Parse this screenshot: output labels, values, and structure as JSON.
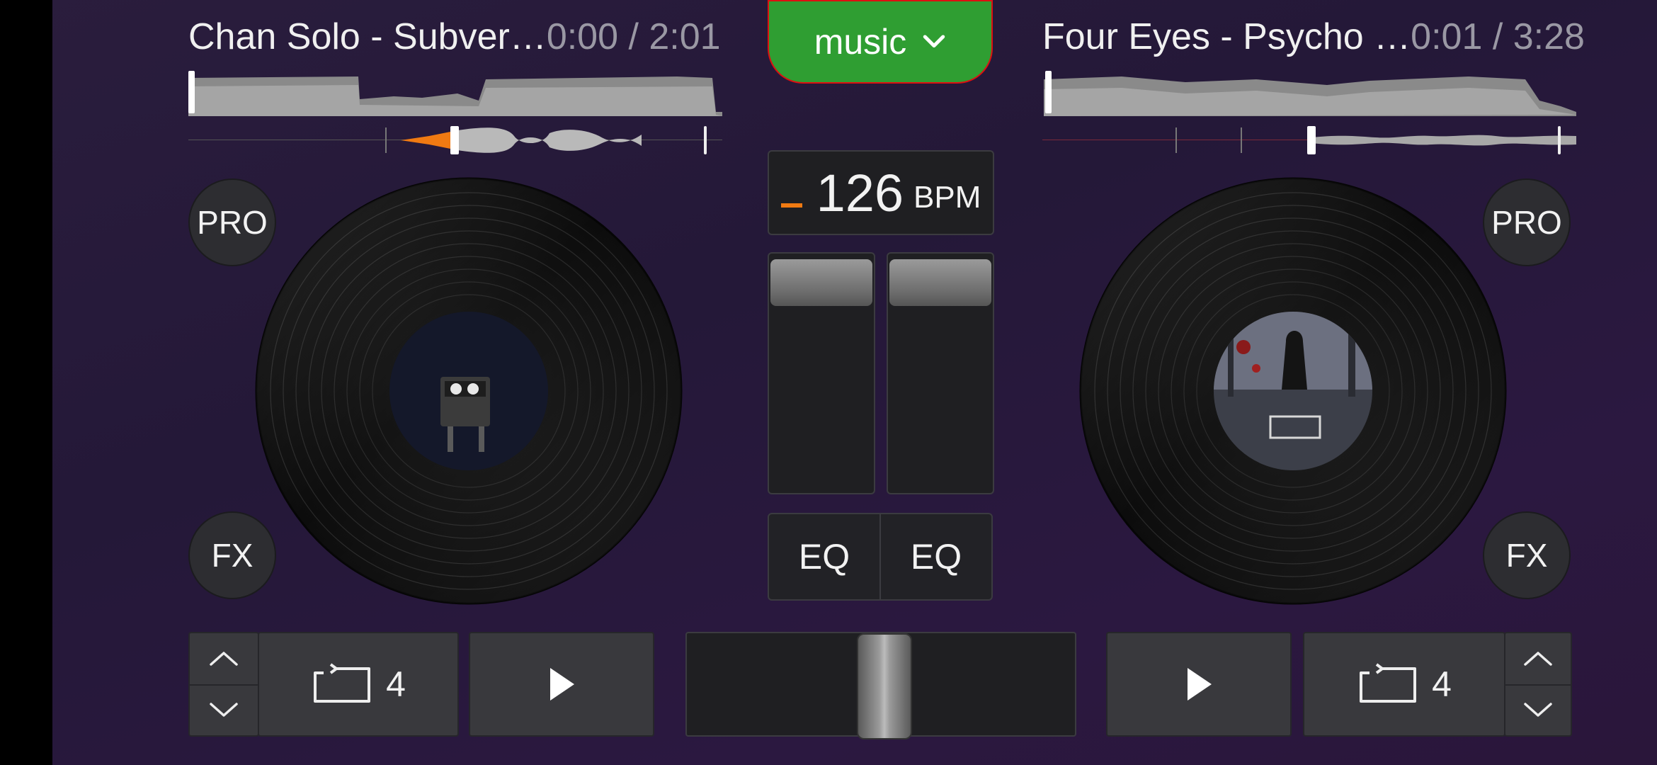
{
  "deck_left": {
    "title": "Chan Solo - Subver…",
    "time_elapsed": "0:00",
    "time_sep": " / ",
    "time_total": "2:01",
    "pro_label": "PRO",
    "fx_label": "FX",
    "loop_count": "4"
  },
  "deck_right": {
    "title": "Four Eyes - Psycho …",
    "time_elapsed": "0:01",
    "time_sep": " / ",
    "time_total": "3:28",
    "pro_label": "PRO",
    "fx_label": "FX",
    "loop_count": "4"
  },
  "mixer": {
    "source_label": "music",
    "bpm_value": "126",
    "bpm_unit": "BPM",
    "eq_left_label": "EQ",
    "eq_right_label": "EQ"
  },
  "colors": {
    "accent_green": "#2f9e32",
    "accent_orange": "#f07a12",
    "highlight_red": "#dd1111"
  }
}
